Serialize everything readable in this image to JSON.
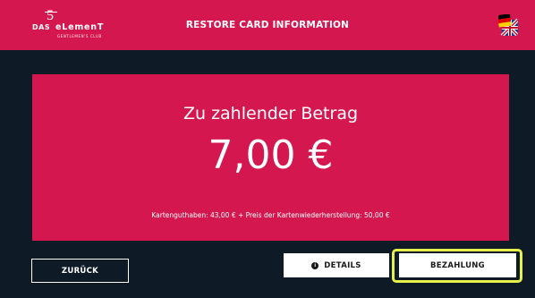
{
  "header": {
    "title": "RESTORE CARD INFORMATION",
    "logo": {
      "numeral": "5",
      "das": "DAS",
      "element": "eLemenT",
      "subtitle": "GENTLEMEN'S CLUB"
    },
    "language_icon": "flag-de-uk-icon"
  },
  "payment": {
    "heading": "Zu zahlender Betrag",
    "amount": "7,00 €",
    "breakdown": "Kartenguthaben: 43,00 € + Preis der Kartenwiederherstellung: 50,00 €"
  },
  "actions": {
    "back_label": "ZURÜCK",
    "details_label": "DETAILS",
    "details_icon": "info-icon",
    "pay_label": "BEZAHLUNG"
  },
  "colors": {
    "brand": "#d5174f",
    "background": "#0e1a26",
    "highlight": "#e5f04a"
  }
}
